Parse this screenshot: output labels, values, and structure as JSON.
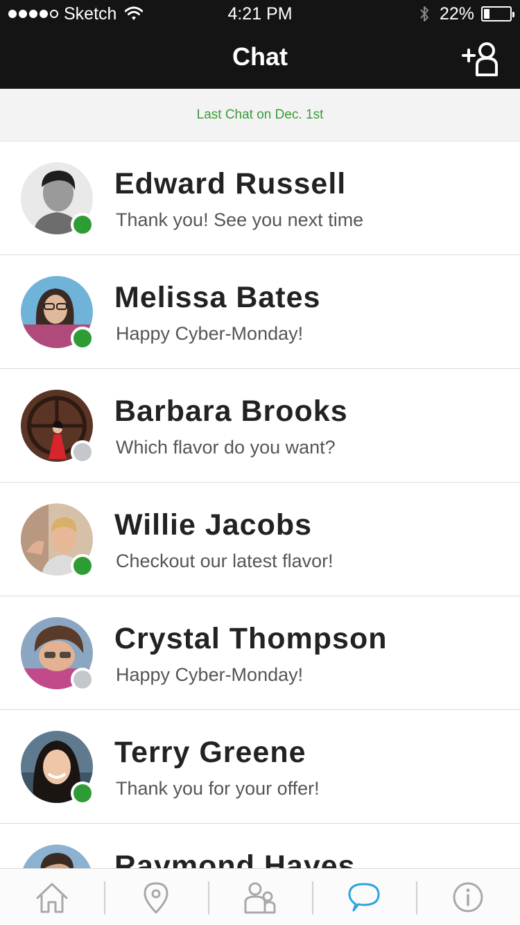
{
  "status_bar": {
    "carrier": "Sketch",
    "time": "4:21 PM",
    "battery_percent": "22%",
    "battery_level": 0.22
  },
  "nav": {
    "title": "Chat",
    "add_icon": "add-user-icon"
  },
  "subheader": {
    "last_chat": "Last Chat on Dec. 1st"
  },
  "colors": {
    "online": "#2e9c34",
    "offline": "#c4c8cc",
    "subheader_text": "#3a9a3a",
    "tab_active": "#2aa4e0",
    "tab_inactive": "#a8a8a8"
  },
  "chats": [
    {
      "name": "Edward Russell",
      "message": "Thank you! See you next time",
      "status": "online"
    },
    {
      "name": "Melissa Bates",
      "message": "Happy Cyber-Monday!",
      "status": "online"
    },
    {
      "name": "Barbara Brooks",
      "message": "Which flavor do you want?",
      "status": "offline"
    },
    {
      "name": "Willie Jacobs",
      "message": "Checkout our latest flavor!",
      "status": "online"
    },
    {
      "name": "Crystal Thompson",
      "message": "Happy Cyber-Monday!",
      "status": "offline"
    },
    {
      "name": "Terry Greene",
      "message": "Thank you for your offer!",
      "status": "online"
    },
    {
      "name": "Raymond Hayes",
      "message": "",
      "status": "online"
    }
  ],
  "tabs": [
    {
      "icon": "home-icon",
      "active": false
    },
    {
      "icon": "location-pin-icon",
      "active": false
    },
    {
      "icon": "contacts-icon",
      "active": false
    },
    {
      "icon": "chat-bubble-icon",
      "active": true
    },
    {
      "icon": "info-icon",
      "active": false
    }
  ]
}
